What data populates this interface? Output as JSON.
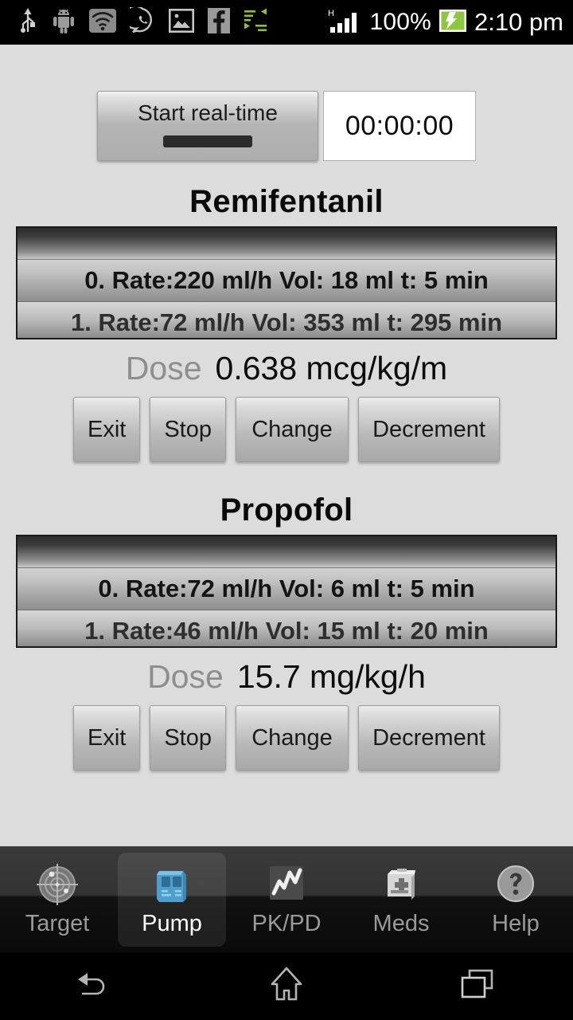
{
  "statusbar": {
    "icons": [
      "usb-icon",
      "android-icon",
      "wifi-icon",
      "whatsapp-icon",
      "photo-icon",
      "facebook-icon",
      "sync-arrows-icon"
    ],
    "network_type": "H",
    "signal": "signal-bars-icon",
    "battery_percent": "100%",
    "battery_icon": "battery-charging-icon",
    "battery_color": "#8dc63f",
    "time": "2:10 pm"
  },
  "toolbar": {
    "start_button_label": "Start real-time",
    "timer_value": "00:00:00"
  },
  "drugs": [
    {
      "name": "Remifentanil",
      "steps": [
        {
          "text": "0. Rate:220 ml/h Vol: 18 ml t: 5 min"
        },
        {
          "text": "1. Rate:72 ml/h Vol: 353 ml t: 295 min"
        }
      ],
      "dose_label": "Dose",
      "dose_value": "0.638 mcg/kg/m",
      "buttons": [
        "Exit",
        "Stop",
        "Change",
        "Decrement"
      ]
    },
    {
      "name": "Propofol",
      "steps": [
        {
          "text": "0. Rate:72 ml/h Vol: 6 ml t: 5 min"
        },
        {
          "text": "1. Rate:46 ml/h Vol: 15 ml t: 20 min"
        }
      ],
      "dose_label": "Dose",
      "dose_value": "15.7 mg/kg/h",
      "buttons": [
        "Exit",
        "Stop",
        "Change",
        "Decrement"
      ]
    }
  ],
  "tabs": [
    {
      "label": "Target",
      "icon": "radar-target-icon",
      "selected": false
    },
    {
      "label": "Pump",
      "icon": "infusion-pump-icon",
      "selected": true
    },
    {
      "label": "PK/PD",
      "icon": "line-chart-icon",
      "selected": false
    },
    {
      "label": "Meds",
      "icon": "medical-kit-icon",
      "selected": false
    },
    {
      "label": "Help",
      "icon": "question-mark-icon",
      "selected": false
    }
  ],
  "navbar": {
    "back": "back-icon",
    "home": "home-icon",
    "recents": "recent-apps-icon"
  },
  "colors": {
    "background": "#dcdcdc",
    "accent_pump": "#5aa9d6",
    "battery_green": "#8dc63f"
  }
}
